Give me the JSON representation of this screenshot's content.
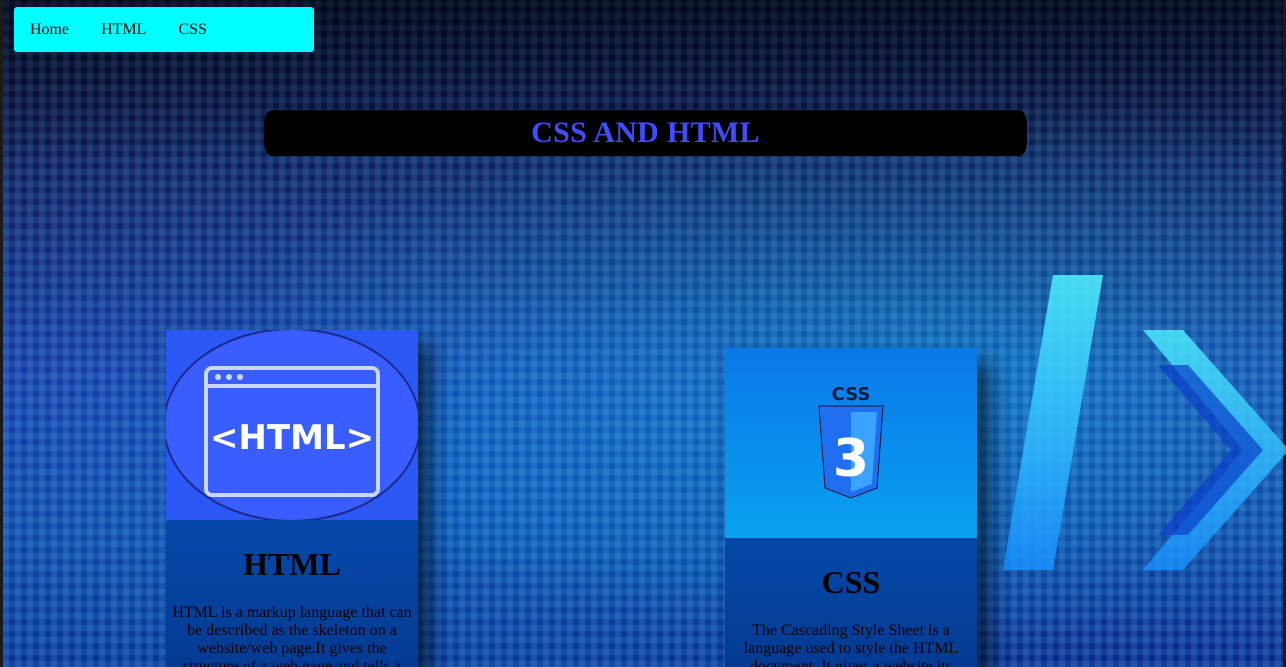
{
  "nav": {
    "items": [
      {
        "label": "Home"
      },
      {
        "label": "HTML"
      },
      {
        "label": "CSS"
      }
    ]
  },
  "title": "CSS AND HTML",
  "cards": [
    {
      "image_label": "<HTML>",
      "title": "HTML",
      "text": "HTML is a markup language that can be described as the skeleton on a website/web page.It gives the structure of a web page and tells a browser how"
    },
    {
      "image_label": "CSS",
      "image_number": "3",
      "title": "CSS",
      "text": "The Cascading Style Sheet is a language used to style the HTML document. It gives a website its"
    }
  ],
  "colors": {
    "nav_bg": "#00ffff",
    "title_text": "#3f4cff",
    "title_bg": "#000000",
    "card_bg": "#0a5cc0"
  }
}
